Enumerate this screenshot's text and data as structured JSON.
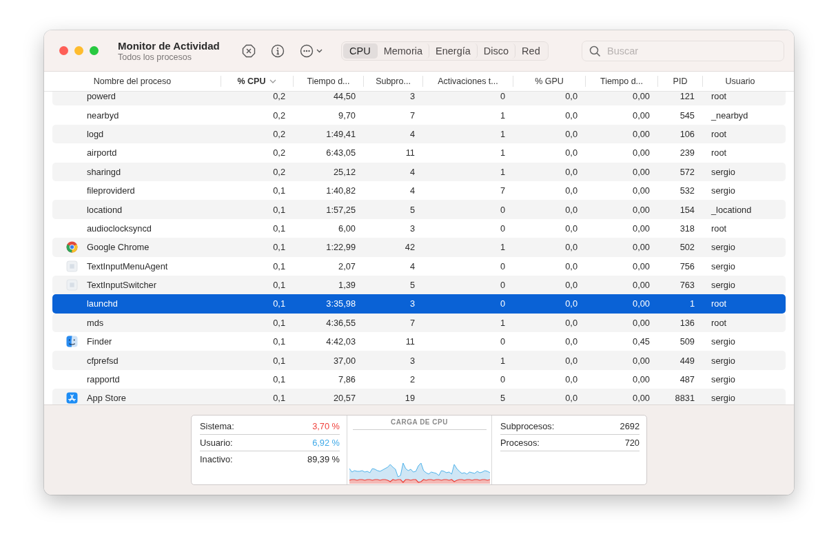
{
  "window": {
    "title": "Monitor de Actividad",
    "subtitle": "Todos los procesos"
  },
  "tabs": [
    {
      "label": "CPU",
      "selected": true
    },
    {
      "label": "Memoria",
      "selected": false
    },
    {
      "label": "Energía",
      "selected": false
    },
    {
      "label": "Disco",
      "selected": false
    },
    {
      "label": "Red",
      "selected": false
    }
  ],
  "search": {
    "placeholder": "Buscar"
  },
  "table": {
    "columns": [
      {
        "label": "Nombre del proceso",
        "sorted": false
      },
      {
        "label": "% CPU",
        "sorted": true
      },
      {
        "label": "Tiempo d...",
        "sorted": false
      },
      {
        "label": "Subpro...",
        "sorted": false
      },
      {
        "label": "Activaciones t...",
        "sorted": false
      },
      {
        "label": "% GPU",
        "sorted": false
      },
      {
        "label": "Tiempo d...",
        "sorted": false
      },
      {
        "label": "PID",
        "sorted": false
      },
      {
        "label": "Usuario",
        "sorted": false
      }
    ],
    "rows": [
      {
        "kind": "none",
        "selected": false,
        "cells": [
          "powerd",
          "0,2",
          "44,50",
          "3",
          "0",
          "0,0",
          "0,00",
          "121",
          "root"
        ]
      },
      {
        "kind": "none",
        "selected": false,
        "cells": [
          "nearbyd",
          "0,2",
          "9,70",
          "7",
          "1",
          "0,0",
          "0,00",
          "545",
          "_nearbyd"
        ]
      },
      {
        "kind": "none",
        "selected": false,
        "cells": [
          "logd",
          "0,2",
          "1:49,41",
          "4",
          "1",
          "0,0",
          "0,00",
          "106",
          "root"
        ]
      },
      {
        "kind": "none",
        "selected": false,
        "cells": [
          "airportd",
          "0,2",
          "6:43,05",
          "11",
          "1",
          "0,0",
          "0,00",
          "239",
          "root"
        ]
      },
      {
        "kind": "none",
        "selected": false,
        "cells": [
          "sharingd",
          "0,2",
          "25,12",
          "4",
          "1",
          "0,0",
          "0,00",
          "572",
          "sergio"
        ]
      },
      {
        "kind": "none",
        "selected": false,
        "cells": [
          "fileproviderd",
          "0,1",
          "1:40,82",
          "4",
          "7",
          "0,0",
          "0,00",
          "532",
          "sergio"
        ]
      },
      {
        "kind": "none",
        "selected": false,
        "cells": [
          "locationd",
          "0,1",
          "1:57,25",
          "5",
          "0",
          "0,0",
          "0,00",
          "154",
          "_locationd"
        ]
      },
      {
        "kind": "none",
        "selected": false,
        "cells": [
          "audioclocksyncd",
          "0,1",
          "6,00",
          "3",
          "0",
          "0,0",
          "0,00",
          "318",
          "root"
        ]
      },
      {
        "kind": "chrome",
        "selected": false,
        "cells": [
          "Google Chrome",
          "0,1",
          "1:22,99",
          "42",
          "1",
          "0,0",
          "0,00",
          "502",
          "sergio"
        ]
      },
      {
        "kind": "generic",
        "selected": false,
        "cells": [
          "TextInputMenuAgent",
          "0,1",
          "2,07",
          "4",
          "0",
          "0,0",
          "0,00",
          "756",
          "sergio"
        ]
      },
      {
        "kind": "generic",
        "selected": false,
        "cells": [
          "TextInputSwitcher",
          "0,1",
          "1,39",
          "5",
          "0",
          "0,0",
          "0,00",
          "763",
          "sergio"
        ]
      },
      {
        "kind": "none",
        "selected": true,
        "cells": [
          "launchd",
          "0,1",
          "3:35,98",
          "3",
          "0",
          "0,0",
          "0,00",
          "1",
          "root"
        ]
      },
      {
        "kind": "none",
        "selected": false,
        "cells": [
          "mds",
          "0,1",
          "4:36,55",
          "7",
          "1",
          "0,0",
          "0,00",
          "136",
          "root"
        ]
      },
      {
        "kind": "finder",
        "selected": false,
        "cells": [
          "Finder",
          "0,1",
          "4:42,03",
          "11",
          "0",
          "0,0",
          "0,45",
          "509",
          "sergio"
        ]
      },
      {
        "kind": "none",
        "selected": false,
        "cells": [
          "cfprefsd",
          "0,1",
          "37,00",
          "3",
          "1",
          "0,0",
          "0,00",
          "449",
          "sergio"
        ]
      },
      {
        "kind": "none",
        "selected": false,
        "cells": [
          "rapportd",
          "0,1",
          "7,86",
          "2",
          "0",
          "0,0",
          "0,00",
          "487",
          "sergio"
        ]
      },
      {
        "kind": "appstore",
        "selected": false,
        "cells": [
          "App Store",
          "0,1",
          "20,57",
          "19",
          "5",
          "0,0",
          "0,00",
          "8831",
          "sergio"
        ]
      }
    ]
  },
  "summary": {
    "load": [
      {
        "label": "Sistema:",
        "value": "3,70 %",
        "color": "#f0413c"
      },
      {
        "label": "Usuario:",
        "value": "6,92 %",
        "color": "#3fa9e8"
      },
      {
        "label": "Inactivo:",
        "value": "89,39 %",
        "color": "#262626"
      }
    ],
    "chart_title": "CARGA DE CPU",
    "counts": [
      {
        "label": "Subprocesos:",
        "value": "2692"
      },
      {
        "label": "Procesos:",
        "value": "720"
      }
    ]
  }
}
